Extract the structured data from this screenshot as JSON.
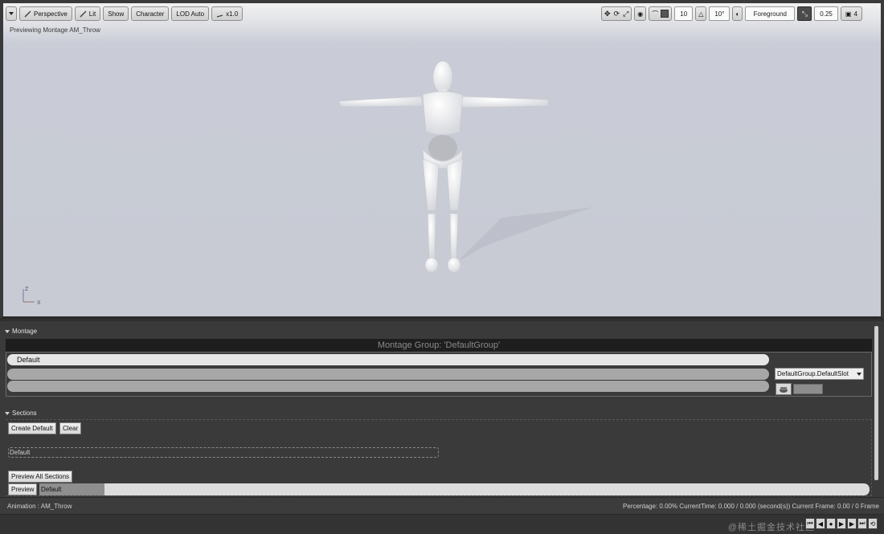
{
  "viewport": {
    "toolbar": {
      "perspective": "Perspective",
      "lit": "Lit",
      "show": "Show",
      "character": "Character",
      "lod": "LOD Auto",
      "speed": "x1.0",
      "grid_size": "10",
      "rotation_snap": "10°",
      "layer": "Foreground",
      "scale": "0.25",
      "camera_speed": "4"
    },
    "preview_text": "Previewing Montage AM_Throw",
    "axis": {
      "z": "Z",
      "x": "X"
    }
  },
  "montage": {
    "header": "Montage",
    "group_title": "Montage Group: 'DefaultGroup'",
    "track_label": "Default",
    "slot_select": "DefaultGroup.DefaultSlot"
  },
  "sections": {
    "header": "Sections",
    "create_default": "Create Default",
    "clear": "Clear",
    "section_default": "Default",
    "preview_all": "Preview All Sections",
    "preview": "Preview",
    "preview_default": "Default"
  },
  "status": {
    "animation": "Animation :  AM_Throw",
    "info": "Percentage:  0.00%  CurrentTime:  0.000 / 0.000 (second(s))  Current Frame:  0.00 / 0 Frame"
  },
  "watermark": "@稀土掘金技术社区",
  "transport_icons": [
    "skip-back-icon",
    "step-back-icon",
    "record-icon",
    "play-icon",
    "step-forward-icon",
    "skip-forward-icon",
    "loop-icon"
  ]
}
